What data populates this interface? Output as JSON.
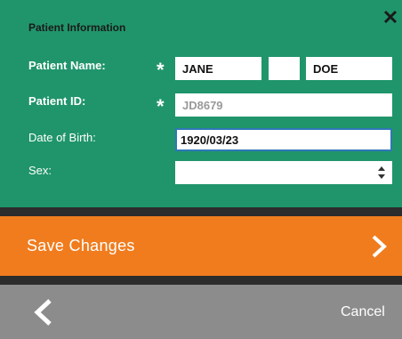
{
  "form": {
    "title": "Patient Information",
    "patient_name_label": "Patient Name:",
    "patient_id_label": "Patient ID:",
    "dob_label": "Date of Birth:",
    "sex_label": "Sex:",
    "required_marker": "*",
    "first_name_value": "JANE",
    "middle_name_value": "",
    "last_name_value": "DOE",
    "patient_id_placeholder": "JD8679",
    "dob_value": "1920/03/23",
    "sex_value": ""
  },
  "actions": {
    "save_label": "Save Changes",
    "cancel_label": "Cancel"
  },
  "colors": {
    "panel": "#20956b",
    "save_bar": "#f07c1e",
    "bottom_bar": "#8c8c8c",
    "divider": "#2c2c2c",
    "focus_border": "#2f77b8"
  },
  "icons": {
    "close": "close-icon",
    "save_arrow": "chevron-right-icon",
    "back": "chevron-left-icon",
    "select_arrows": "sort-arrows-icon"
  }
}
